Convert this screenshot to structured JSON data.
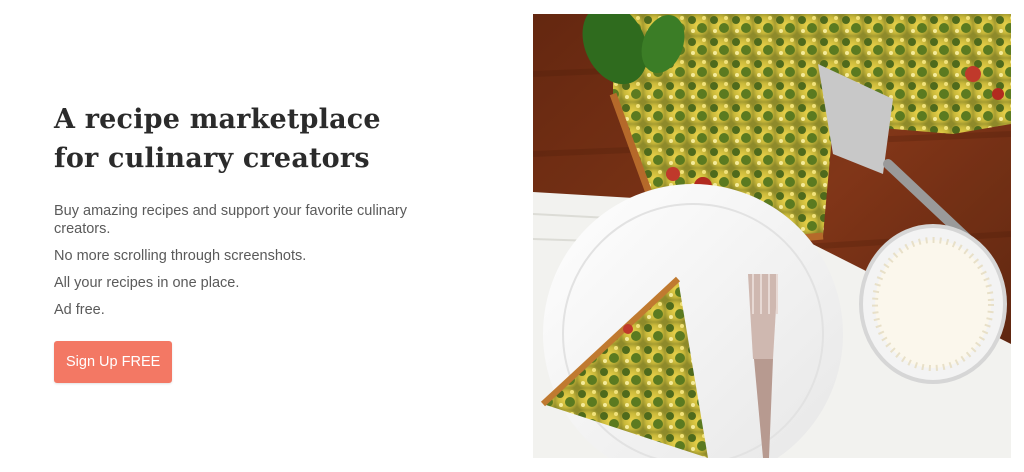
{
  "hero": {
    "title": "A recipe marketplace for culinary creators",
    "lines": [
      "Buy amazing recipes and support your favorite culinary creators.",
      "No more scrolling through screenshots.",
      "All your recipes in one place.",
      "Ad free."
    ],
    "cta_label": "Sign Up FREE"
  },
  "colors": {
    "accent": "#f37864",
    "title": "#2b2b2b",
    "body": "#5a5a5a"
  }
}
